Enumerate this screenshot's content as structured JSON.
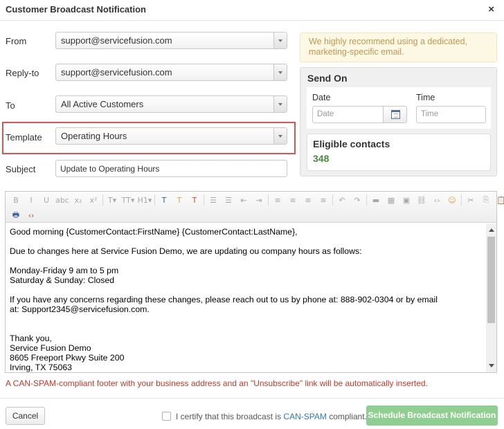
{
  "dialog": {
    "title": "Customer Broadcast Notification",
    "close_glyph": "×"
  },
  "form": {
    "from": {
      "label": "From",
      "value": "support@servicefusion.com"
    },
    "reply_to": {
      "label": "Reply-to",
      "value": "support@servicefusion.com"
    },
    "to": {
      "label": "To",
      "value": "All Active Customers"
    },
    "template": {
      "label": "Template",
      "value": "Operating Hours"
    },
    "subject": {
      "label": "Subject",
      "value": "Update to Operating Hours"
    }
  },
  "notice": "We highly recommend using a dedicated, marketing-specific email.",
  "send_on": {
    "title": "Send On",
    "date_label": "Date",
    "date_placeholder": "Date",
    "time_label": "Time",
    "time_placeholder": "Time"
  },
  "eligible": {
    "title": "Eligible contacts",
    "count": "348"
  },
  "editor": {
    "toolbar_row1": [
      {
        "name": "bold-icon",
        "glyph": "B"
      },
      {
        "name": "italic-icon",
        "glyph": "I"
      },
      {
        "name": "underline-icon",
        "glyph": "U"
      },
      {
        "name": "strikethrough-icon",
        "glyph": "abc"
      },
      {
        "name": "subscript-icon",
        "glyph": "x₂"
      },
      {
        "name": "superscript-icon",
        "glyph": "x²"
      },
      {
        "name": "font-family-icon",
        "glyph": "T▾"
      },
      {
        "name": "font-size-icon",
        "glyph": "TT▾"
      },
      {
        "name": "heading-icon",
        "glyph": "H1▾"
      },
      {
        "name": "text-style-icon",
        "glyph": "T"
      },
      {
        "name": "highlight-icon",
        "glyph": "T"
      },
      {
        "name": "clear-format-icon",
        "glyph": "T"
      },
      {
        "name": "bullet-list-icon",
        "glyph": "☰"
      },
      {
        "name": "numbered-list-icon",
        "glyph": "☰"
      },
      {
        "name": "outdent-icon",
        "glyph": "⇤"
      },
      {
        "name": "indent-icon",
        "glyph": "⇥"
      },
      {
        "name": "align-left-icon",
        "glyph": "≡"
      },
      {
        "name": "align-center-icon",
        "glyph": "≡"
      },
      {
        "name": "align-right-icon",
        "glyph": "≡"
      },
      {
        "name": "align-justify-icon",
        "glyph": "≡"
      },
      {
        "name": "undo-icon",
        "glyph": "↶"
      },
      {
        "name": "redo-icon",
        "glyph": "↷"
      },
      {
        "name": "horizontal-rule-icon",
        "glyph": "▬"
      },
      {
        "name": "table-icon",
        "glyph": "▦"
      },
      {
        "name": "image-icon",
        "glyph": "▣"
      },
      {
        "name": "link-icon",
        "glyph": "⛓"
      },
      {
        "name": "code-icon",
        "glyph": "‹›"
      },
      {
        "name": "emoticon-icon",
        "glyph": "☺"
      },
      {
        "name": "cut-icon",
        "glyph": "✂"
      },
      {
        "name": "copy-icon",
        "glyph": "⎘"
      },
      {
        "name": "paste-icon",
        "glyph": "📋"
      },
      {
        "name": "paste-word-icon",
        "glyph": "📋"
      }
    ],
    "toolbar_row2": [
      {
        "name": "print-icon",
        "glyph": "🖶"
      },
      {
        "name": "html-source-icon",
        "glyph": "‹›"
      }
    ],
    "body_lines": [
      "Good morning {CustomerContact:FirstName} {CustomerContact:LastName},",
      "",
      "Due to changes here at Service Fusion Demo, we are updating ou company hours as follows:",
      "",
      "Monday-Friday 9 am to 5 pm",
      "Saturday & Sunday: Closed",
      "",
      "If you have any concerns regarding these changes, please reach out to us by phone at: 888-902-0304 or by email",
      "at: Support2345@servicefusion.com.",
      "",
      "",
      "Thank you,",
      "Service Fusion Demo",
      "8605 Freeport Pkwy Suite 200",
      "Irving, TX 75063"
    ]
  },
  "footer_note": "A CAN-SPAM-compliant footer with your business address and an \"Unsubscribe\" link will be automatically inserted.",
  "actions": {
    "cancel_label": "Cancel",
    "certify_prefix": "I certify that this broadcast is ",
    "certify_link": "CAN-SPAM",
    "certify_suffix": " compliant.",
    "schedule_label": "Schedule Broadcast Notification"
  },
  "colors": {
    "accent_green": "#8fcf91",
    "eligible_green": "#4a8a3c",
    "warning_text": "#c09853",
    "error_red": "#c0392b",
    "highlight_red": "#e05252"
  }
}
